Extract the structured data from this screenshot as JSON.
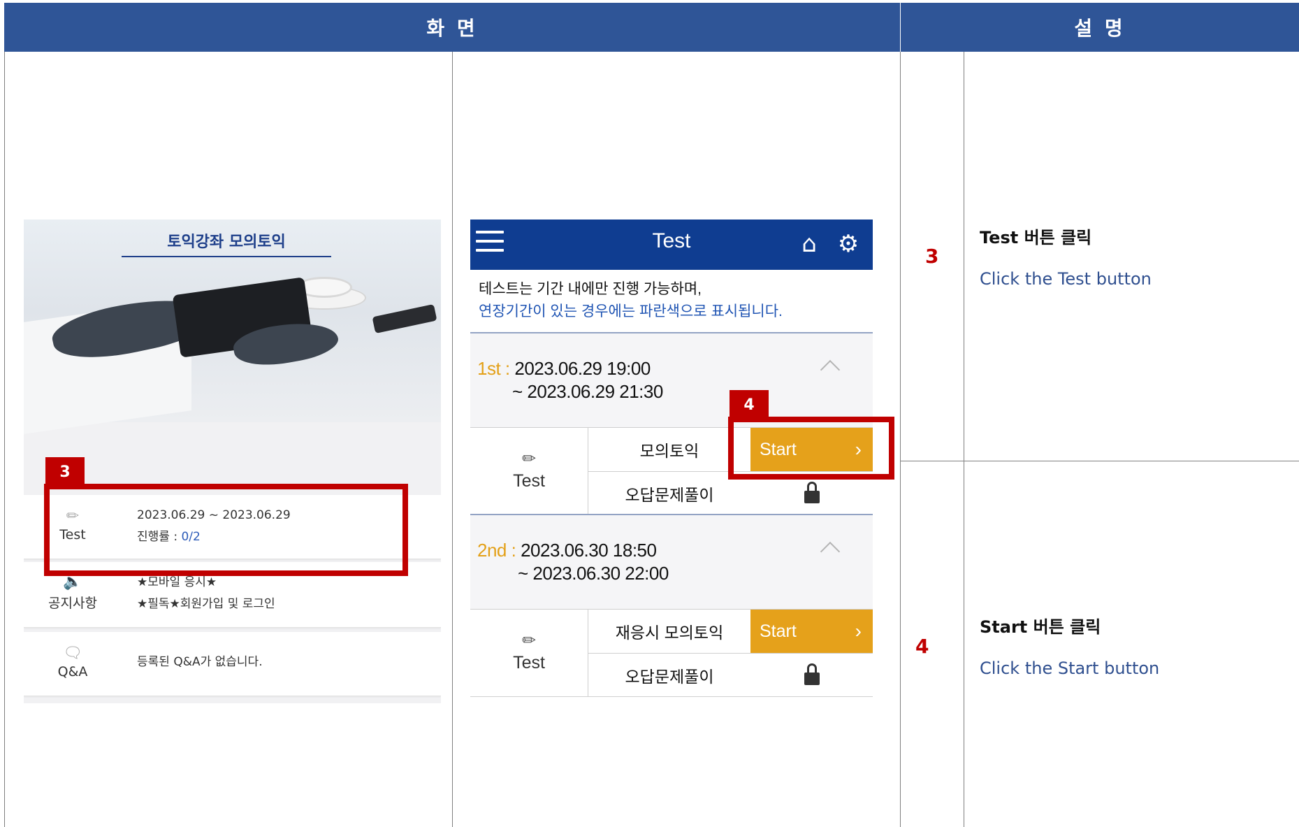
{
  "header": {
    "screen": "화 면",
    "description": "설 명"
  },
  "screen1": {
    "banner_title": "토익강좌 모의토익",
    "test_card": {
      "icon_label": "Test",
      "period": "2023.06.29 ~ 2023.06.29",
      "progress_label": "진행률 : ",
      "progress_value": "0/2"
    },
    "notice_card": {
      "icon_label": "공지사항",
      "line1": "★모바일 응시★",
      "line2": "★필독★회원가입 및 로그인"
    },
    "qa_card": {
      "icon_label": "Q&A",
      "text": "등록된 Q&A가 없습니다."
    },
    "callout": "3"
  },
  "screen2": {
    "title": "Test",
    "notice_line1": "테스트는 기간 내에만 진행 가능하며,",
    "notice_line2": "연장기간이 있는 경우에는 파란색으로 표시됩니다.",
    "sessions": [
      {
        "order": "1st",
        "start": "2023.06.29 19:00",
        "end": "~ 2023.06.29 21:30",
        "left_label": "Test",
        "row1": "모의토익",
        "row2": "오답문제풀이",
        "button": "Start"
      },
      {
        "order": "2nd",
        "start": "2023.06.30 18:50",
        "end": "~ 2023.06.30 22:00",
        "left_label": "Test",
        "row1": "재응시 모의토익",
        "row2": "오답문제풀이",
        "button": "Start"
      }
    ],
    "callout": "4"
  },
  "steps": [
    {
      "number": "3",
      "title": "Test 버튼 클릭",
      "desc": "Click the Test button"
    },
    {
      "number": "4",
      "title": "Start 버튼 클릭",
      "desc": "Click the Start button"
    }
  ],
  "colors": {
    "header": "#2f5597",
    "callout": "#c00000",
    "app_bar": "#0f3d91",
    "start_button": "#e5a11b"
  },
  "icons": [
    "menu-icon",
    "home-icon",
    "settings-icon",
    "pencil-icon",
    "speaker-icon",
    "chat-icon",
    "lock-icon",
    "chevron-right-icon",
    "chevron-up-icon"
  ]
}
